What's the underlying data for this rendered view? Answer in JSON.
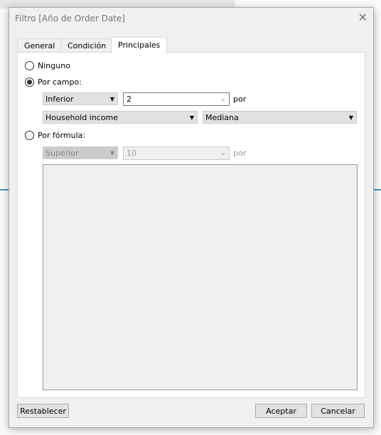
{
  "dialog": {
    "title": "Filtro [Año de Order Date]"
  },
  "tabs": [
    {
      "label": "General"
    },
    {
      "label": "Condición"
    },
    {
      "label": "Principales",
      "active": true
    }
  ],
  "options": {
    "none": {
      "label": "Ninguno",
      "selected": false
    },
    "by_field": {
      "label": "Por campo:",
      "selected": true,
      "direction": "Inferior",
      "count": "2",
      "by": "por",
      "field": "Household income",
      "aggregation": "Mediana"
    },
    "by_formula": {
      "label": "Por fórmula:",
      "selected": false,
      "direction": "Superior",
      "count": "10",
      "by": "por"
    }
  },
  "buttons": {
    "reset": "Restablecer",
    "ok": "Aceptar",
    "cancel": "Cancelar"
  }
}
